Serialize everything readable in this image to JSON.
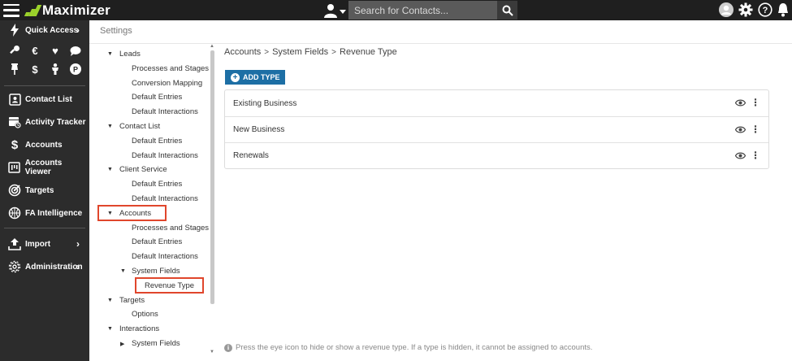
{
  "app": {
    "name": "Maximizer"
  },
  "search": {
    "placeholder": "Search for Contacts..."
  },
  "nav": {
    "quick_access": "Quick Access",
    "items": [
      {
        "label": "Contact List"
      },
      {
        "label": "Activity Tracker"
      },
      {
        "label": "Accounts"
      },
      {
        "label": "Accounts Viewer"
      },
      {
        "label": "Targets"
      },
      {
        "label": "FA Intelligence"
      },
      {
        "label": "Import"
      },
      {
        "label": "Administration"
      }
    ]
  },
  "settings": {
    "title": "Settings"
  },
  "tree": [
    {
      "label": "Leads",
      "level": 0,
      "caret": "▼"
    },
    {
      "label": "Processes and Stages",
      "level": 1
    },
    {
      "label": "Conversion Mapping",
      "level": 1
    },
    {
      "label": "Default Entries",
      "level": 1
    },
    {
      "label": "Default Interactions",
      "level": 1
    },
    {
      "label": "Contact List",
      "level": 0,
      "caret": "▼"
    },
    {
      "label": "Default Entries",
      "level": 1
    },
    {
      "label": "Default Interactions",
      "level": 1
    },
    {
      "label": "Client Service",
      "level": 0,
      "caret": "▼"
    },
    {
      "label": "Default Entries",
      "level": 1
    },
    {
      "label": "Default Interactions",
      "level": 1
    },
    {
      "label": "Accounts",
      "level": 0,
      "caret": "▼"
    },
    {
      "label": "Processes and Stages",
      "level": 1
    },
    {
      "label": "Default Entries",
      "level": 1
    },
    {
      "label": "Default Interactions",
      "level": 1
    },
    {
      "label": "System Fields",
      "level": 1,
      "caret": "▼"
    },
    {
      "label": "Revenue Type",
      "level": 2
    },
    {
      "label": "Targets",
      "level": 0,
      "caret": "▼"
    },
    {
      "label": "Options",
      "level": 1
    },
    {
      "label": "Interactions",
      "level": 0,
      "caret": "▼"
    },
    {
      "label": "System Fields",
      "level": 1,
      "caret": "▶"
    }
  ],
  "breadcrumb": [
    "Accounts",
    "System Fields",
    "Revenue Type"
  ],
  "add_button": {
    "label": "ADD TYPE"
  },
  "revenue_types": [
    {
      "name": "Existing Business"
    },
    {
      "name": "New Business"
    },
    {
      "name": "Renewals"
    }
  ],
  "footnote": "Press the eye icon to hide or show a revenue type. If a type is hidden, it cannot be assigned to accounts.",
  "colors": {
    "accent": "#1d6fa5",
    "highlight": "#e0462c",
    "logo_green": "#9bd22b",
    "nav_bg": "#2c2c2c"
  }
}
